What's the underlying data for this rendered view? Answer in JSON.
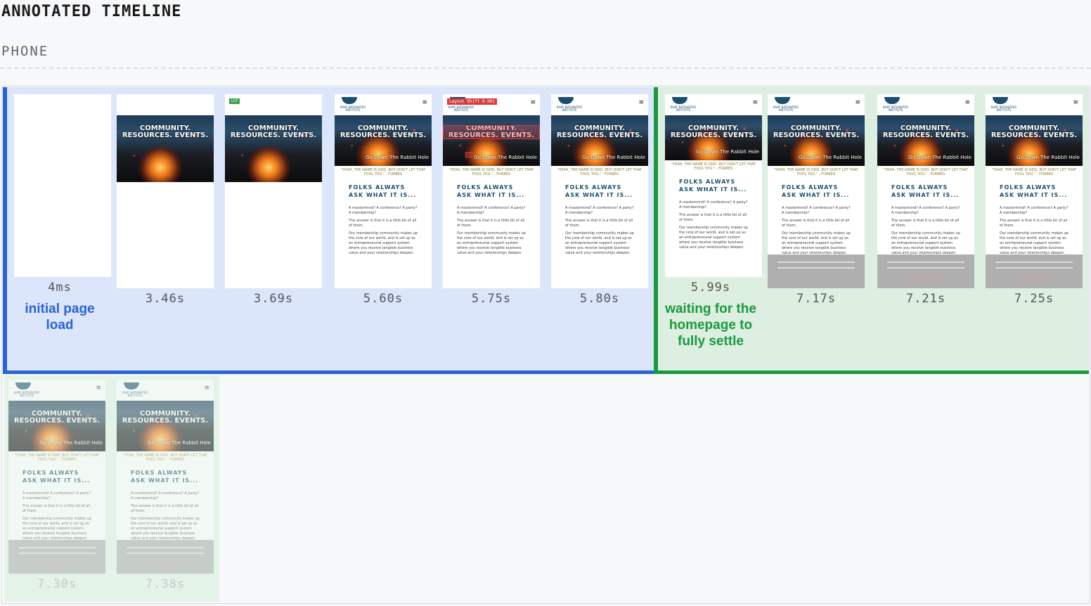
{
  "page": {
    "title": "ANNOTATED TIMELINE",
    "device": "PHONE"
  },
  "site": {
    "logo_text": "BABY BATHWATER INSTITUTE",
    "hero_heading": "COMMUNITY. RESOURCES. EVENTS.",
    "hero_sub": "Go Down The Rabbit Hole",
    "quote": "\"YEAH, THE NAME IS ODD, BUT DON'T LET THAT FOOL YOU.\" - FORBES",
    "ask_heading": "FOLKS ALWAYS ASK WHAT IT IS...",
    "p1": "A mastermind? A conference? A party? A membership?",
    "p2": "The answer is that it is a little bit of all of them.",
    "p3": "Our membership community makes up the core of our world, and is set up as an entrepreneurial support system where you receive tangible business value and your relationships deepen.",
    "menu_glyph": "≡"
  },
  "badges": {
    "lcp": "LCP",
    "layout_shift": "Layout Shift 0.001"
  },
  "annotations": {
    "initial": "initial page load",
    "settle": "waiting for the homepage to fully settle"
  },
  "frames": [
    {
      "time": "4ms"
    },
    {
      "time": "3.46s"
    },
    {
      "time": "3.69s"
    },
    {
      "time": "5.60s"
    },
    {
      "time": "5.75s"
    },
    {
      "time": "5.80s"
    },
    {
      "time": "5.99s"
    },
    {
      "time": "7.17s"
    },
    {
      "time": "7.21s"
    },
    {
      "time": "7.25s"
    },
    {
      "time": "7.30s"
    },
    {
      "time": "7.38s"
    }
  ],
  "colors": {
    "blue": "#2a63d6",
    "green": "#1a9a3f",
    "shift_red": "#d8393b"
  }
}
